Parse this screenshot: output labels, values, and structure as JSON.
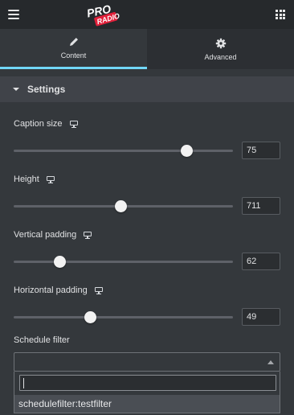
{
  "header": {
    "logo_text_top": "PRO",
    "logo_text_bottom": "RADIO",
    "menu_icon": "hamburger-menu-icon",
    "apps_icon": "grid-apps-icon"
  },
  "tabs": [
    {
      "label": "Content",
      "icon": "pencil-icon",
      "active": true
    },
    {
      "label": "Advanced",
      "icon": "gear-icon",
      "active": false
    }
  ],
  "section": {
    "title": "Settings",
    "expanded": true
  },
  "controls": [
    {
      "label": "Caption size",
      "value": "75",
      "slider_fraction": 0.79,
      "responsive_icon": "desktop-icon"
    },
    {
      "label": "Height",
      "value": "711",
      "slider_fraction": 0.49,
      "responsive_icon": "desktop-icon"
    },
    {
      "label": "Vertical padding",
      "value": "62",
      "slider_fraction": 0.21,
      "responsive_icon": "desktop-icon"
    },
    {
      "label": "Horizontal padding",
      "value": "49",
      "slider_fraction": 0.35,
      "responsive_icon": "desktop-icon"
    }
  ],
  "schedule_filter": {
    "label": "Schedule filter",
    "selected": "",
    "search_value": "",
    "options": [
      "schedulefilter:testfilter"
    ]
  },
  "colors": {
    "accent": "#71d7f7",
    "background": "#34383c",
    "topbar": "#26292c",
    "logo_red": "#e2203a"
  }
}
